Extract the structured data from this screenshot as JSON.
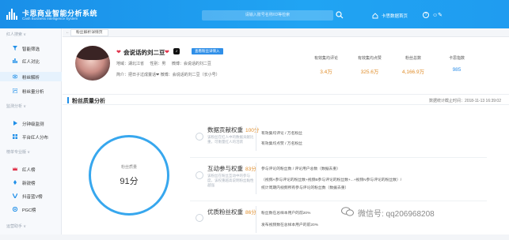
{
  "header": {
    "brand_title": "卡思商业智能分析系统",
    "brand_sub": "Cash Business Intelligence System",
    "search_placeholder": "请输入账号名称/ID等检索",
    "home_label": "卡思数据首页",
    "help_label": "?",
    "user_label": "☺✎"
  },
  "sidebar": {
    "groups": [
      {
        "label": "红人搜索 ∨"
      },
      {
        "label": "监测分析 ∨"
      },
      {
        "label": "榜单专业版 ∨"
      },
      {
        "label": "运营助手 ∨"
      }
    ],
    "items": [
      {
        "label": "智能筛选",
        "icon": "filter-icon"
      },
      {
        "label": "红人对比",
        "icon": "compare-icon"
      },
      {
        "label": "粉丝解析",
        "icon": "eye-icon"
      },
      {
        "label": "粉丝量分析",
        "icon": "chart-icon"
      },
      {
        "label": "分钟级监测",
        "icon": "play-icon"
      },
      {
        "label": "平台红人分布",
        "icon": "grid-icon"
      },
      {
        "label": "红人榜",
        "icon": "crown-icon"
      },
      {
        "label": "新锐榜",
        "icon": "rocket-icon"
      },
      {
        "label": "抖音蓝V榜",
        "icon": "v-icon"
      },
      {
        "label": "PGC榜",
        "icon": "pgc-icon"
      }
    ]
  },
  "breadcrumb": {
    "back": "←",
    "tab": "粉丝解析详情页"
  },
  "profile": {
    "nickname": "会说话的刘二豆",
    "view_link": "查看粉丝详情入",
    "meta": [
      "地域：湖北江省",
      "性别：男",
      "微博：会说话的刘二豆"
    ],
    "intro": "简介：把日子过成童话❤ 微博：会说话的刘二豆（长小号）",
    "stats": [
      {
        "label": "有效集均评论",
        "value": "3.4万",
        "color": "orange"
      },
      {
        "label": "有效集均点赞",
        "value": "325.6万",
        "color": "orange"
      },
      {
        "label": "粉丝总数",
        "value": "4,166.9万",
        "color": "orange"
      },
      {
        "label": "卡思指数",
        "value": "985",
        "color": "blue"
      }
    ]
  },
  "section": {
    "title": "粉丝质量分析",
    "update_time": "数据统计截止时间：2018-11-13 16:39:02"
  },
  "quality": {
    "label": "粉丝质量",
    "score": "91分"
  },
  "metrics": [
    {
      "title": "数据贡献权重",
      "score": "100分",
      "desc": "该粉丝在红人中的数据贡献比重，可衡量红人的活跃",
      "lines": [
        "有效集均评论 / 万名粉丝",
        "有效集均点赞 / 万名粉丝"
      ]
    },
    {
      "title": "互动参与权重",
      "score": "83分",
      "desc": "该粉丝在粉丝互动中的参与度，该权重越高说明粉丝黏性越强",
      "lines": [
        "参与评论的粉丝数 / 评论用户总数（数据去重）",
        "（视频A参与评论的粉丝数+视频B参与评论的粉丝数+...+视频N参与评论的粉丝数）/",
        "统计周期内视频所有参与评论的粉丝数（数据去重）"
      ]
    },
    {
      "title": "优质粉丝权重",
      "score": "86分",
      "desc": "",
      "lines": [
        "粉丝数在总样本用户的前20%",
        "发布视频数在总样本用户的前20%"
      ]
    }
  ],
  "watermark": {
    "text": "微信号: qq206968208"
  },
  "colors": {
    "brand": "#1f9cf0",
    "accent_orange": "#e08d2a",
    "accent_blue": "#2f8fe8",
    "ring": "#37a7ee"
  }
}
